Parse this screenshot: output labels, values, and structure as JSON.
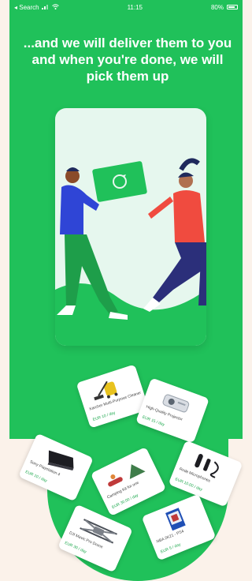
{
  "status_bar": {
    "carrier": "◂ Search",
    "time": "11:15",
    "battery": "80%"
  },
  "headline": "...and we will deliver them to you and when you're done, we will pick them up",
  "colors": {
    "brand_green": "#20c15a",
    "background": "#fbf2ea"
  },
  "products": [
    {
      "name": "Karcher Multi-Purpose Cleaner",
      "price": "EUR 10 / day",
      "icon": "vacuum-cleaner-icon"
    },
    {
      "name": "High-Quality Projector",
      "price": "EUR 15 / day",
      "icon": "projector-icon"
    },
    {
      "name": "Sony Playstation 4",
      "price": "EUR 10 / day",
      "icon": "console-icon"
    },
    {
      "name": "Camping Kit for one",
      "price": "EUR 30.00 / day",
      "icon": "tent-icon"
    },
    {
      "name": "Rode Microphones",
      "price": "EUR 10.00 / day",
      "icon": "microphone-icon"
    },
    {
      "name": "DJI Mavic Pro Drone",
      "price": "EUR 30 / day",
      "icon": "drone-icon"
    },
    {
      "name": "NBA 2K21 - PS4",
      "price": "EUR 5 / day",
      "icon": "game-case-icon"
    }
  ]
}
